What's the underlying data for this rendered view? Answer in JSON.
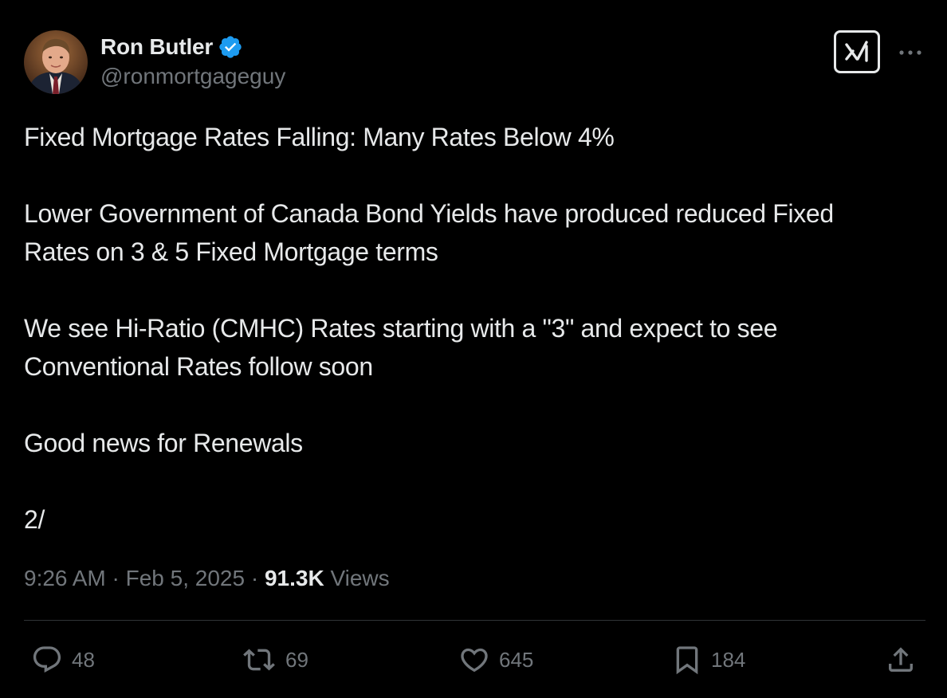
{
  "author": {
    "display_name": "Ron Butler",
    "handle": "@ronmortgageguy",
    "verified": true,
    "avatar_icon": "profile-photo"
  },
  "header": {
    "grok_icon": "grok-icon",
    "more_icon": "more-icon"
  },
  "tweet": {
    "paragraphs": [
      "Fixed Mortgage Rates Falling: Many Rates Below 4%",
      "Lower Government of Canada Bond Yields have produced reduced Fixed\nRates on 3 & 5 Fixed Mortgage terms",
      "We see Hi-Ratio (CMHC) Rates starting with a \"3\" and expect to see\nConventional Rates follow soon",
      "Good news for Renewals",
      "2/"
    ],
    "time": "9:26 AM",
    "separator": "·",
    "date": "Feb 5, 2025",
    "views_count": "91.3K",
    "views_label": "Views"
  },
  "actions": {
    "replies": "48",
    "reposts": "69",
    "likes": "645",
    "bookmarks": "184"
  },
  "colors": {
    "background": "#000000",
    "text": "#e7e9ea",
    "secondary": "#71767b",
    "verified_blue": "#1d9bf0",
    "divider": "#2f3336"
  }
}
